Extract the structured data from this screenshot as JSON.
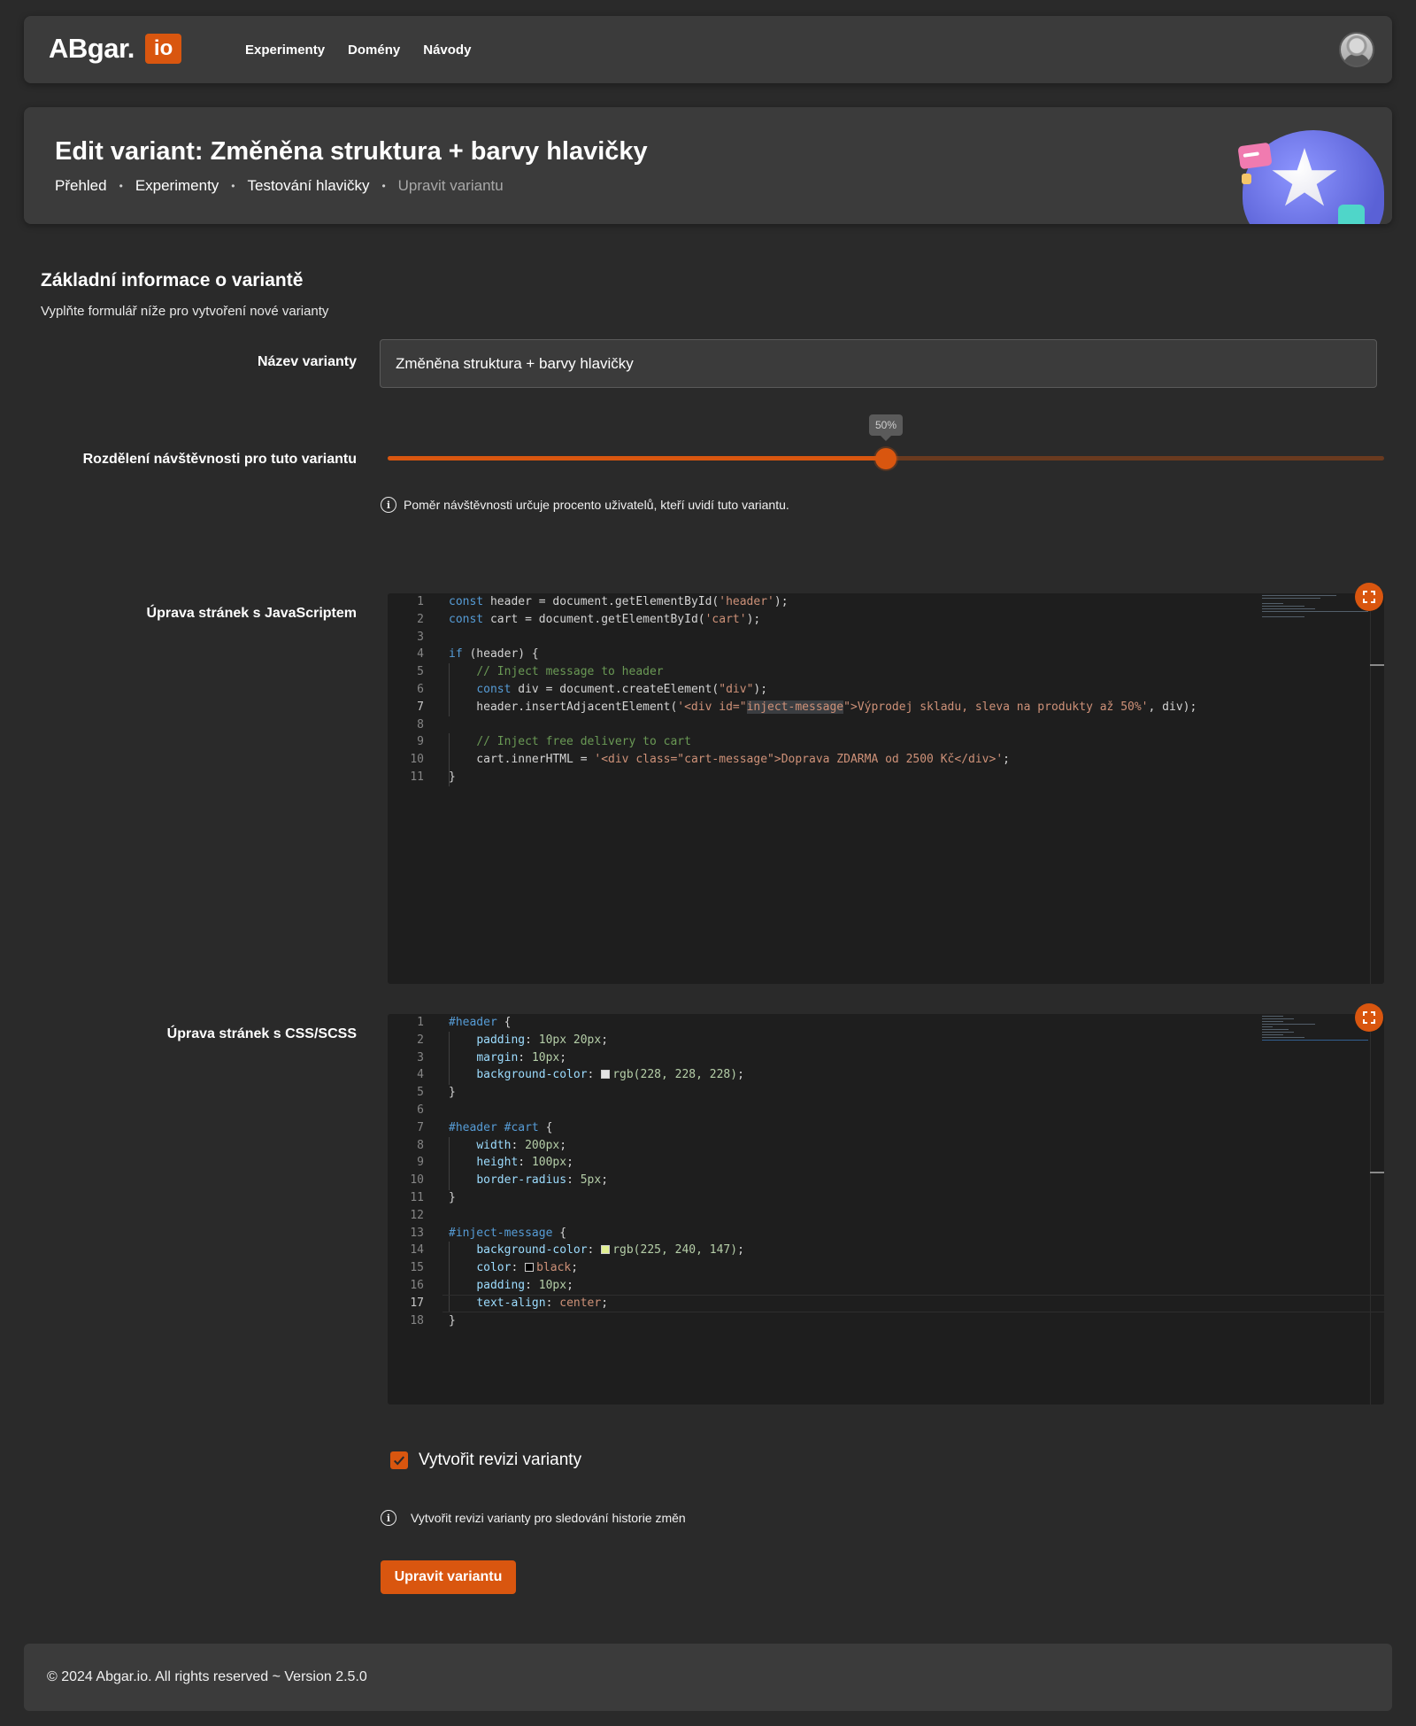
{
  "navbar": {
    "logo_text": "ABgar.",
    "logo_badge": "io",
    "links": [
      "Experimenty",
      "Domény",
      "Návody"
    ]
  },
  "header": {
    "title": "Edit variant: Změněna struktura + barvy hlavičky",
    "breadcrumb": [
      "Přehled",
      "Experimenty",
      "Testování hlavičky",
      "Upravit variantu"
    ]
  },
  "form": {
    "section_title": "Základní informace o variantě",
    "section_subtitle": "Vyplňte formulář níže pro vytvoření nové varianty",
    "name_label": "Název varianty",
    "name_value": "Změněna struktura + barvy hlavičky",
    "split_label": "Rozdělení návštěvnosti pro tuto variantu",
    "split_percent": 50,
    "split_tooltip": "50%",
    "split_hint": "Poměr návštěvnosti určuje procento uživatelů, kteří uvidí tuto variantu.",
    "js_label": "Úprava stránek s JavaScriptem",
    "css_label": "Úprava stránek s CSS/SCSS",
    "revision_label": "Vytvořit revizi varianty",
    "revision_checked": true,
    "revision_hint": "Vytvořit revizi varianty pro sledování historie změn",
    "submit_label": "Upravit variantu"
  },
  "js_editor": {
    "line_numbers": [
      "1",
      "2",
      "3",
      "4",
      "5",
      "6",
      "7",
      "8",
      "9",
      "10",
      "11"
    ],
    "active_line": "7",
    "lines": [
      "const header = document.getElementById('header');",
      "const cart = document.getElementById('cart');",
      "",
      "if (header) {",
      "    // Inject message to header",
      "    const div = document.createElement(\"div\");",
      "    header.insertAdjacentElement('<div id=\"inject-message\">Výprodej skladu, sleva na produkty až 50%', div);",
      "",
      "    // Inject free delivery to cart",
      "    cart.innerHTML = '<div class=\"cart-message\">Doprava ZDARMA od 2500 Kč</div>';",
      "}"
    ]
  },
  "css_editor": {
    "line_numbers": [
      "1",
      "2",
      "3",
      "4",
      "5",
      "6",
      "7",
      "8",
      "9",
      "10",
      "11",
      "12",
      "13",
      "14",
      "15",
      "16",
      "17",
      "18"
    ],
    "active_line": "17",
    "lines": [
      "#header {",
      "    padding: 10px 20px;",
      "    margin: 10px;",
      "    background-color: rgb(228, 228, 228);",
      "}",
      "",
      "#header #cart {",
      "    width: 200px;",
      "    height: 100px;",
      "    border-radius: 5px;",
      "}",
      "",
      "#inject-message {",
      "    background-color: rgb(225, 240, 147);",
      "    color: black;",
      "    padding: 10px;",
      "    text-align: center;",
      "}"
    ],
    "swatches": {
      "header_bg": "#e4e4e4",
      "inject_bg": "#e1f093",
      "inject_color": "#000000"
    }
  },
  "footer": {
    "text": "© 2024 Abgar.io. All rights reserved ~ Version 2.5.0"
  },
  "icons": [
    "info-icon",
    "expand-icon",
    "check-icon",
    "avatar"
  ],
  "colors": {
    "accent": "#d9560f",
    "background": "#2a2a2a",
    "panel": "#3b3b3b",
    "editor": "#1e1e1e"
  }
}
